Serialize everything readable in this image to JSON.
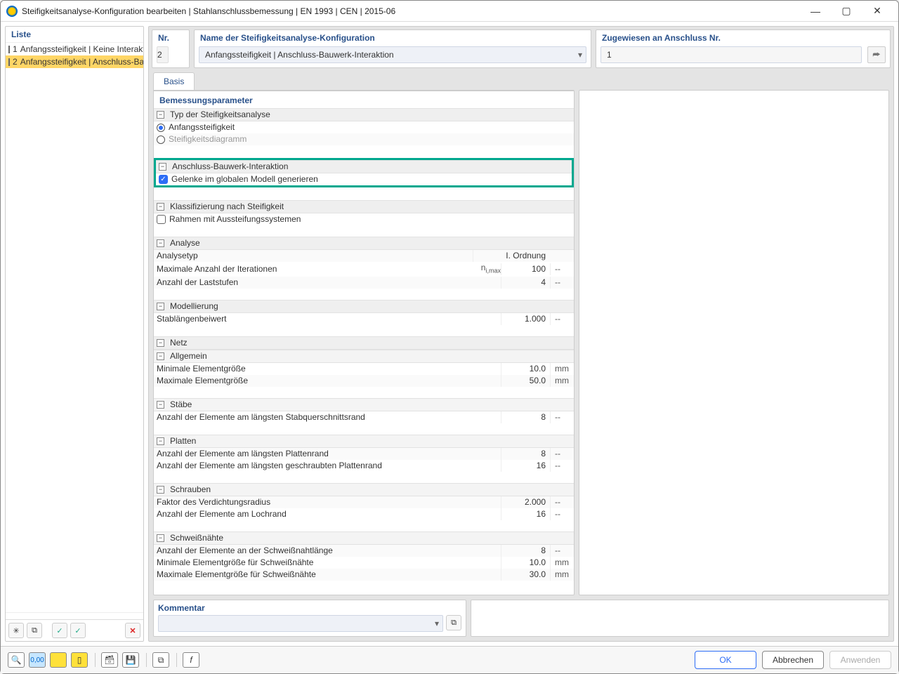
{
  "window": {
    "title": "Steifigkeitsanalyse-Konfiguration bearbeiten | Stahlanschlussbemessung | EN 1993 | CEN | 2015-06"
  },
  "left": {
    "header": "Liste",
    "items": [
      {
        "num": "1",
        "label": "Anfangssteifigkeit | Keine Interaktion",
        "swatch": "#bfe8ef",
        "selected": false
      },
      {
        "num": "2",
        "label": "Anfangssteifigkeit | Anschluss-Bauwerk-Interaktion",
        "swatch": "#bda52a",
        "selected": true
      }
    ],
    "toolbar": {
      "new": "✧",
      "copy": "⧉",
      "check1": "✓",
      "check2": "✓",
      "delete": "✕"
    }
  },
  "top": {
    "nr_label": "Nr.",
    "nr_value": "2",
    "name_label": "Name der Steifigkeitsanalyse-Konfiguration",
    "name_value": "Anfangssteifigkeit | Anschluss-Bauwerk-Interaktion",
    "assigned_label": "Zugewiesen an Anschluss Nr.",
    "assigned_value": "1"
  },
  "tabs": {
    "basis": "Basis"
  },
  "params": {
    "header": "Bemessungsparameter",
    "type": {
      "title": "Typ der Steifigkeitsanalyse",
      "opt1": "Anfangssteifigkeit",
      "opt2": "Steifigkeitsdiagramm"
    },
    "interaction": {
      "title": "Anschluss-Bauwerk-Interaktion",
      "chk": "Gelenke im globalen Modell generieren"
    },
    "classification": {
      "title": "Klassifizierung nach Steifigkeit",
      "chk": "Rahmen mit Aussteifungssystemen"
    },
    "analysis": {
      "title": "Analyse",
      "r1l": "Analysetyp",
      "r1v": "I. Ordnung",
      "r2l": "Maximale Anzahl der Iterationen",
      "r2sym": "ni,max",
      "r2v": "100",
      "r2u": "--",
      "r3l": "Anzahl der Laststufen",
      "r3v": "4",
      "r3u": "--"
    },
    "modelling": {
      "title": "Modellierung",
      "r1l": "Stablängenbeiwert",
      "r1v": "1.000",
      "r1u": "--"
    },
    "mesh": {
      "title": "Netz",
      "general": {
        "title": "Allgemein",
        "r1l": "Minimale Elementgröße",
        "r1v": "10.0",
        "r1u": "mm",
        "r2l": "Maximale Elementgröße",
        "r2v": "50.0",
        "r2u": "mm"
      },
      "members": {
        "title": "Stäbe",
        "r1l": "Anzahl der Elemente am längsten Stabquerschnittsrand",
        "r1v": "8",
        "r1u": "--"
      },
      "plates": {
        "title": "Platten",
        "r1l": "Anzahl der Elemente am längsten Plattenrand",
        "r1v": "8",
        "r1u": "--",
        "r2l": "Anzahl der Elemente am längsten geschraubten Plattenrand",
        "r2v": "16",
        "r2u": "--"
      },
      "bolts": {
        "title": "Schrauben",
        "r1l": "Faktor des Verdichtungsradius",
        "r1v": "2.000",
        "r1u": "--",
        "r2l": "Anzahl der Elemente am Lochrand",
        "r2v": "16",
        "r2u": "--"
      },
      "welds": {
        "title": "Schweißnähte",
        "r1l": "Anzahl der Elemente an der Schweißnahtlänge",
        "r1v": "8",
        "r1u": "--",
        "r2l": "Minimale Elementgröße für Schweißnähte",
        "r2v": "10.0",
        "r2u": "mm",
        "r3l": "Maximale Elementgröße für Schweißnähte",
        "r3v": "30.0",
        "r3u": "mm"
      }
    }
  },
  "comment": {
    "label": "Kommentar"
  },
  "footer": {
    "ok": "OK",
    "cancel": "Abbrechen",
    "apply": "Anwenden"
  }
}
